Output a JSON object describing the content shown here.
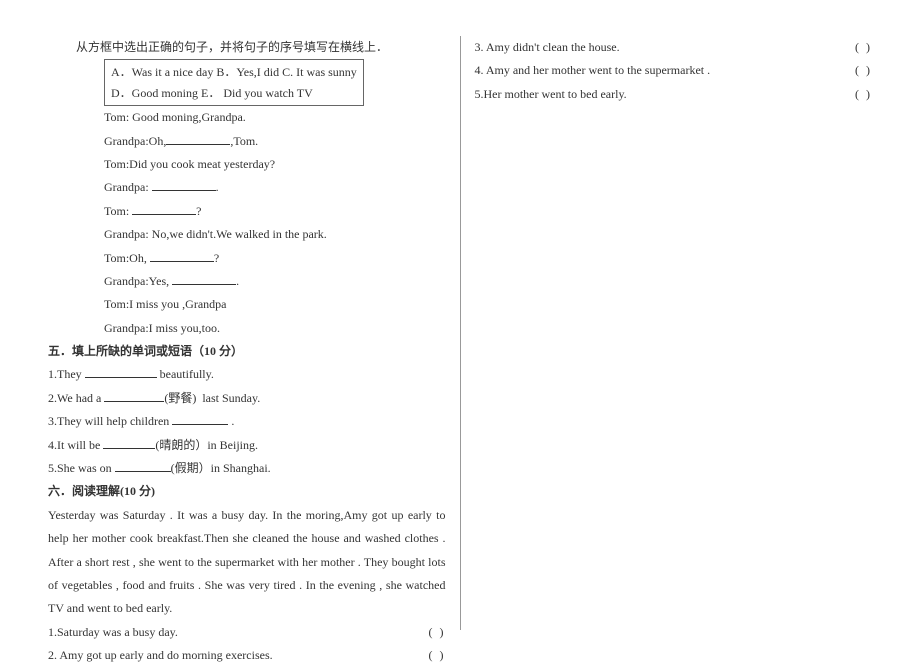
{
  "left": {
    "instruction": "从方框中选出正确的句子，并将句子的序号填写在横线上．",
    "box_line1": "A．Was it a nice day    B．Yes,I did  C. It was sunny",
    "box_line2": "D．Good moning    E． Did you watch TV",
    "dlg": {
      "l1a": "Tom: Good moning,Grandpa.",
      "l2a": "Grandpa:Oh,",
      "l2b": ",Tom.",
      "l3": "Tom:Did you cook meat yesterday?",
      "l4a": "Grandpa: ",
      "l4b": ".",
      "l5a": "Tom: ",
      "l5b": "?",
      "l6": "Grandpa: No,we didn't.We walked in the park.",
      "l7a": "Tom:Oh, ",
      "l7b": "?",
      "l8a": "Grandpa:Yes, ",
      "l8b": ".",
      "l9": "Tom:I miss you ,Grandpa",
      "l10": "Grandpa:I miss you,too."
    },
    "sec5_title": "五．填上所缺的单词或短语（10 分）",
    "s5": {
      "q1a": "1.They ",
      "q1b": " beautifully.",
      "q2a": "2.We had a ",
      "q2b": "(野餐)  last Sunday.",
      "q3a": "3.They will help children ",
      "q3b": " .",
      "q4a": "4.It will be ",
      "q4b": "(晴朗的）in Beijing.",
      "q5a": "5.She was on ",
      "q5b": "(假期）in Shanghai."
    },
    "sec6_title": "六．阅读理解(10 分)",
    "passage": "    Yesterday was Saturday . It was a busy day. In the moring,Amy got up early to help her mother cook breakfast.Then she cleaned the house and washed clothes . After a short rest , she went to the supermarket with her mother . They bought lots of vegetables , food and fruits . She was very tired . In the evening , she watched TV and went to bed early.",
    "tf": {
      "q1": "1.Saturday was a busy day.",
      "q2": "2. Amy got up early and do morning exercises."
    },
    "paren": "(      )"
  },
  "right": {
    "q3": "3. Amy didn't clean the house.",
    "q4": "4. Amy and her mother went to the supermarket .",
    "q5": "5.Her mother went to bed early.",
    "paren": "(      )"
  }
}
